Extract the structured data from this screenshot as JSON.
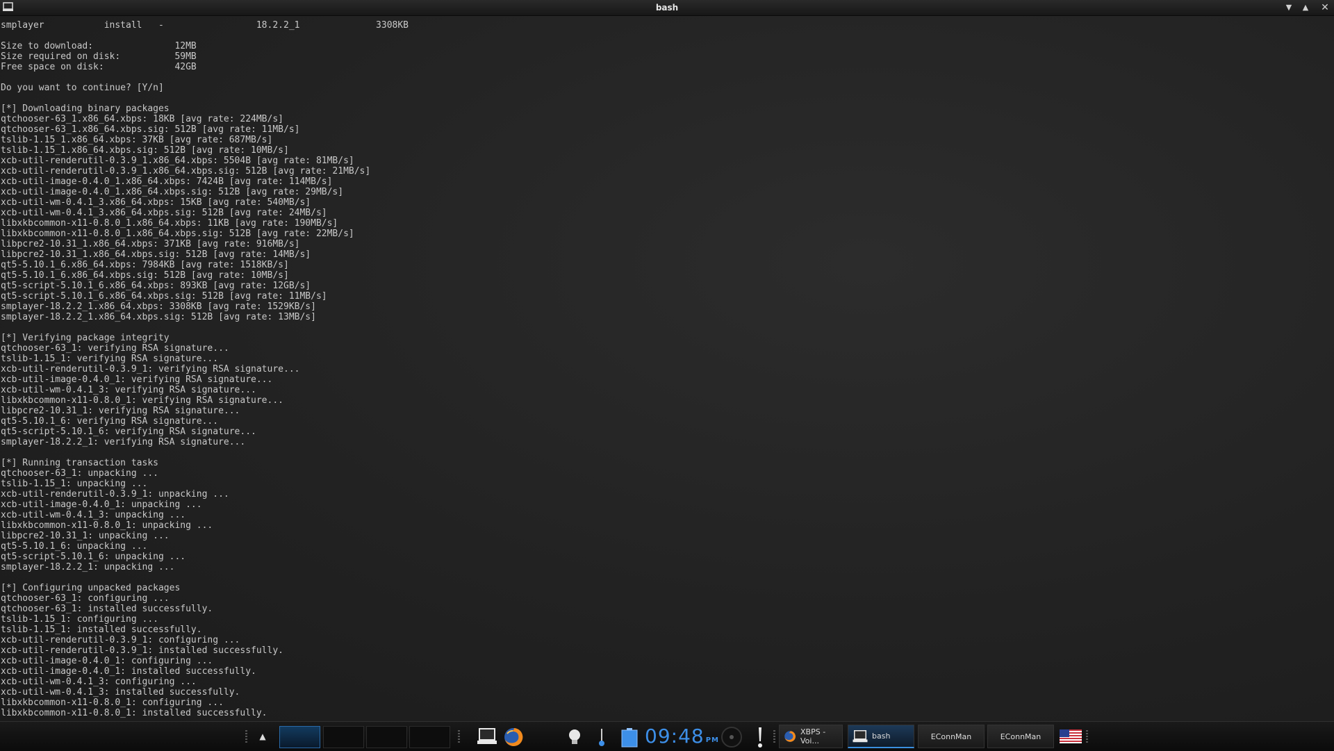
{
  "window": {
    "title": "bash",
    "icon": "terminal-icon"
  },
  "terminal": {
    "lines": [
      "smplayer           install   -                 18.2.2_1              3308KB",
      "",
      "Size to download:               12MB",
      "Size required on disk:          59MB",
      "Free space on disk:             42GB",
      "",
      "Do you want to continue? [Y/n]",
      "",
      "[*] Downloading binary packages",
      "qtchooser-63_1.x86_64.xbps: 18KB [avg rate: 224MB/s]",
      "qtchooser-63_1.x86_64.xbps.sig: 512B [avg rate: 11MB/s]",
      "tslib-1.15_1.x86_64.xbps: 37KB [avg rate: 687MB/s]",
      "tslib-1.15_1.x86_64.xbps.sig: 512B [avg rate: 10MB/s]",
      "xcb-util-renderutil-0.3.9_1.x86_64.xbps: 5504B [avg rate: 81MB/s]",
      "xcb-util-renderutil-0.3.9_1.x86_64.xbps.sig: 512B [avg rate: 21MB/s]",
      "xcb-util-image-0.4.0_1.x86_64.xbps: 7424B [avg rate: 114MB/s]",
      "xcb-util-image-0.4.0_1.x86_64.xbps.sig: 512B [avg rate: 29MB/s]",
      "xcb-util-wm-0.4.1_3.x86_64.xbps: 15KB [avg rate: 540MB/s]",
      "xcb-util-wm-0.4.1_3.x86_64.xbps.sig: 512B [avg rate: 24MB/s]",
      "libxkbcommon-x11-0.8.0_1.x86_64.xbps: 11KB [avg rate: 190MB/s]",
      "libxkbcommon-x11-0.8.0_1.x86_64.xbps.sig: 512B [avg rate: 22MB/s]",
      "libpcre2-10.31_1.x86_64.xbps: 371KB [avg rate: 916MB/s]",
      "libpcre2-10.31_1.x86_64.xbps.sig: 512B [avg rate: 14MB/s]",
      "qt5-5.10.1_6.x86_64.xbps: 7984KB [avg rate: 1518KB/s]",
      "qt5-5.10.1_6.x86_64.xbps.sig: 512B [avg rate: 10MB/s]",
      "qt5-script-5.10.1_6.x86_64.xbps: 893KB [avg rate: 12GB/s]",
      "qt5-script-5.10.1_6.x86_64.xbps.sig: 512B [avg rate: 11MB/s]",
      "smplayer-18.2.2_1.x86_64.xbps: 3308KB [avg rate: 1529KB/s]",
      "smplayer-18.2.2_1.x86_64.xbps.sig: 512B [avg rate: 13MB/s]",
      "",
      "[*] Verifying package integrity",
      "qtchooser-63_1: verifying RSA signature...",
      "tslib-1.15_1: verifying RSA signature...",
      "xcb-util-renderutil-0.3.9_1: verifying RSA signature...",
      "xcb-util-image-0.4.0_1: verifying RSA signature...",
      "xcb-util-wm-0.4.1_3: verifying RSA signature...",
      "libxkbcommon-x11-0.8.0_1: verifying RSA signature...",
      "libpcre2-10.31_1: verifying RSA signature...",
      "qt5-5.10.1_6: verifying RSA signature...",
      "qt5-script-5.10.1_6: verifying RSA signature...",
      "smplayer-18.2.2_1: verifying RSA signature...",
      "",
      "[*] Running transaction tasks",
      "qtchooser-63_1: unpacking ...",
      "tslib-1.15_1: unpacking ...",
      "xcb-util-renderutil-0.3.9_1: unpacking ...",
      "xcb-util-image-0.4.0_1: unpacking ...",
      "xcb-util-wm-0.4.1_3: unpacking ...",
      "libxkbcommon-x11-0.8.0_1: unpacking ...",
      "libpcre2-10.31_1: unpacking ...",
      "qt5-5.10.1_6: unpacking ...",
      "qt5-script-5.10.1_6: unpacking ...",
      "smplayer-18.2.2_1: unpacking ...",
      "",
      "[*] Configuring unpacked packages",
      "qtchooser-63_1: configuring ...",
      "qtchooser-63_1: installed successfully.",
      "tslib-1.15_1: configuring ...",
      "tslib-1.15_1: installed successfully.",
      "xcb-util-renderutil-0.3.9_1: configuring ...",
      "xcb-util-renderutil-0.3.9_1: installed successfully.",
      "xcb-util-image-0.4.0_1: configuring ...",
      "xcb-util-image-0.4.0_1: installed successfully.",
      "xcb-util-wm-0.4.1_3: configuring ...",
      "xcb-util-wm-0.4.1_3: installed successfully.",
      "libxkbcommon-x11-0.8.0_1: configuring ...",
      "libxkbcommon-x11-0.8.0_1: installed successfully."
    ]
  },
  "taskbar": {
    "clock": {
      "time": "09:48",
      "ampm": "PM"
    },
    "tasks": [
      {
        "label": "XBPS - Voi...",
        "icon": "firefox-icon"
      },
      {
        "label": "bash",
        "icon": "terminal-icon",
        "active": true
      },
      {
        "label": "EConnMan"
      },
      {
        "label": "EConnMan"
      }
    ],
    "colors": {
      "accent": "#3d8fe8",
      "active_border": "#3a8fe0"
    }
  }
}
